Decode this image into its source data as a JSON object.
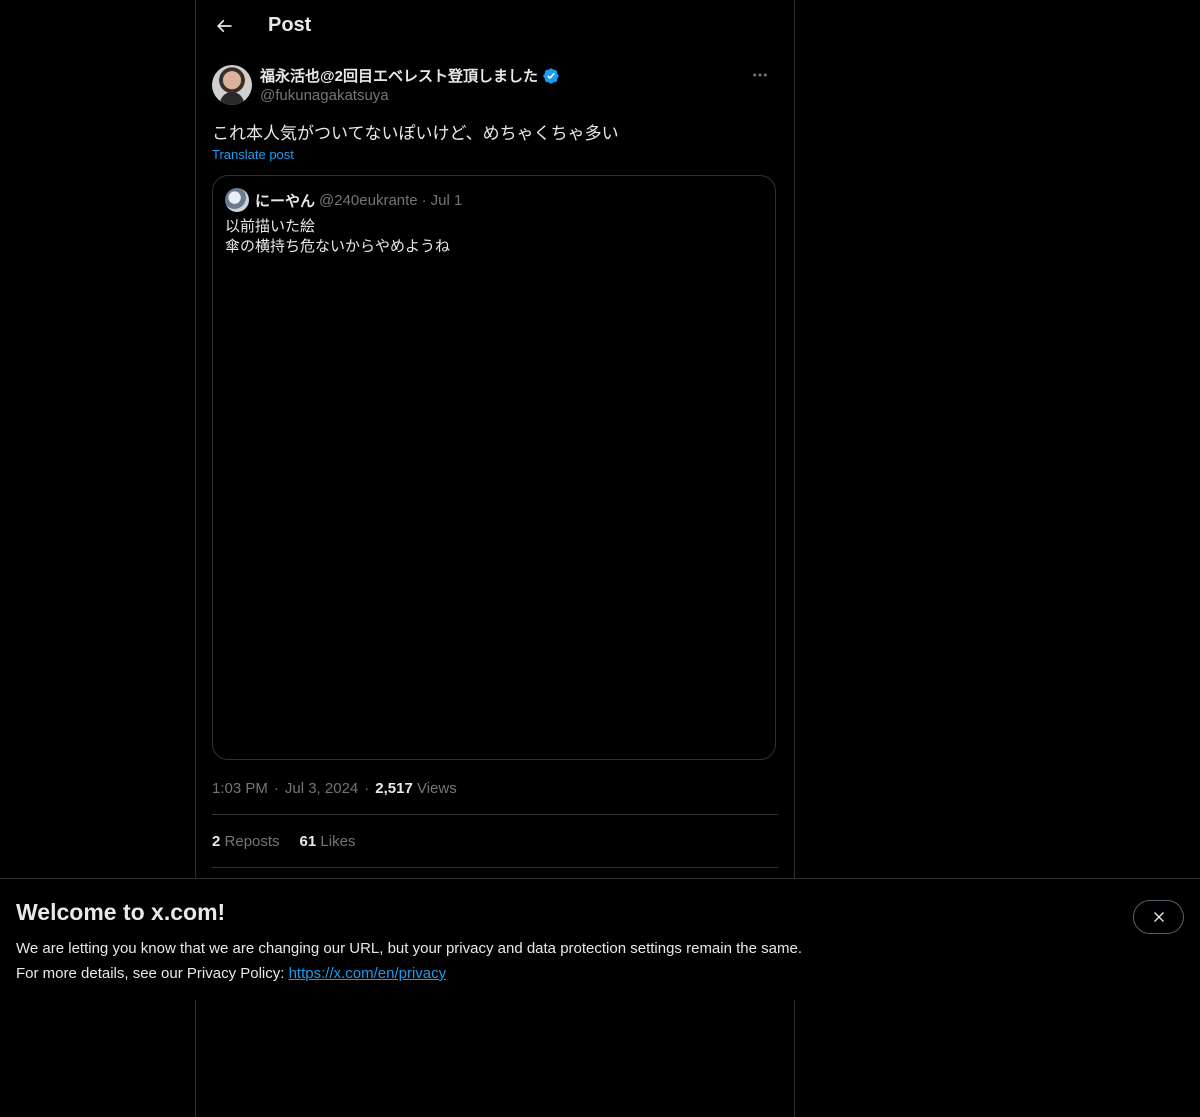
{
  "header": {
    "title": "Post",
    "back_icon": "arrow-left-icon"
  },
  "post": {
    "author": {
      "display_name": "福永活也@2回目エベレスト登頂しました",
      "handle": "@fukunagakatsuya",
      "verified": true,
      "verified_color": "#1d9bf0"
    },
    "text": "これ本人気がついてないぽいけど、めちゃくちゃ多い",
    "translate_label": "Translate post",
    "quote": {
      "display_name": "にーやん",
      "handle": "@240eukrante",
      "separator": "·",
      "date": "Jul 1",
      "lines": [
        "以前描いた絵",
        "傘の横持ち危ないからやめようね"
      ]
    },
    "time": "1:03 PM",
    "date": "Jul 3, 2024",
    "views_count": "2,517",
    "views_label": "Views",
    "reposts_count": "2",
    "reposts_label": "Reposts",
    "likes_count": "61",
    "likes_label": "Likes"
  },
  "banner": {
    "title": "Welcome to x.com!",
    "line1": "We are letting you know that we are changing our URL, but your privacy and data protection settings remain the same.",
    "line2_prefix": "For more details, see our Privacy Policy: ",
    "link_text": "https://x.com/en/privacy",
    "close_icon": "close-icon"
  },
  "colors": {
    "background": "#000000",
    "text_primary": "#e7e9ea",
    "text_secondary": "#71767b",
    "accent": "#1d9bf0",
    "border": "#2f3336"
  }
}
